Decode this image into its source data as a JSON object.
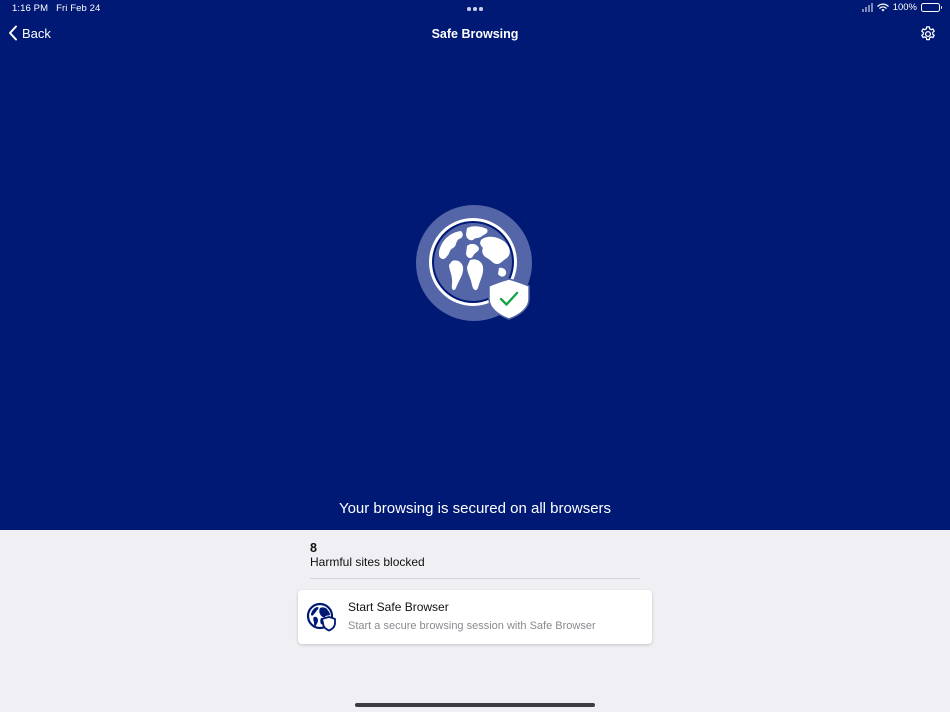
{
  "status_bar": {
    "time": "1:16 PM",
    "date": "Fri Feb 24",
    "battery_text": "100%"
  },
  "nav": {
    "back_label": "Back",
    "title": "Safe Browsing"
  },
  "hero": {
    "headline": "Your browsing is secured on all browsers"
  },
  "stats": {
    "count": "8",
    "label": "Harmful sites blocked"
  },
  "card": {
    "title": "Start Safe Browser",
    "subtitle": "Start a secure browsing session with Safe Browser"
  },
  "icons": {
    "back": "chevron-left-icon",
    "settings": "gear-icon",
    "hero": "globe-shield-check-icon",
    "card": "globe-shield-icon"
  },
  "colors": {
    "hero_background": "#001975",
    "page_background": "#efeff4",
    "check_green": "#16a34a"
  }
}
